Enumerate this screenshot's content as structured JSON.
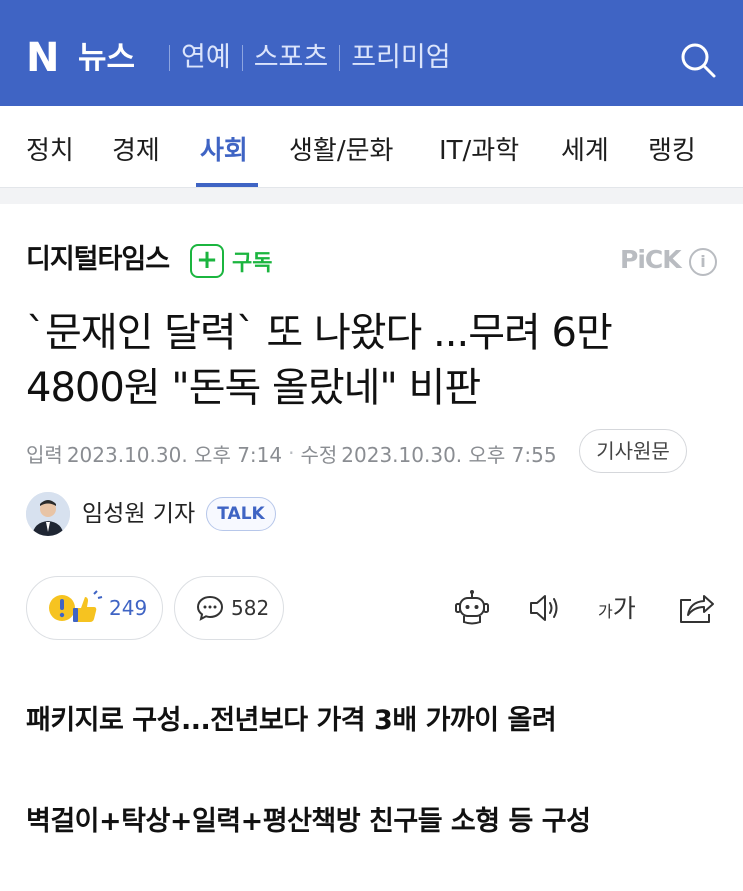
{
  "header": {
    "logo": "N",
    "brand": "뉴스",
    "nav": [
      "연예",
      "스포츠",
      "프리미엄"
    ],
    "search_icon": "search-icon"
  },
  "categories": {
    "items": [
      "정치",
      "경제",
      "사회",
      "생활/문화",
      "IT/과학",
      "세계",
      "랭킹"
    ],
    "active": "사회"
  },
  "press": {
    "name": "디지털타임스",
    "subscribe_label": "구독",
    "pick_label": "PiCK",
    "info_icon": "info-icon"
  },
  "article": {
    "title_line1": "`문재인 달력` 또 나왔다 ...무려 6만",
    "title_line2": "4800원 \"돈독 올랐네\" 비판",
    "published_label": "입력",
    "published": "2023.10.30. 오후 7:14",
    "modified_label": "수정",
    "modified": "2023.10.30. 오후 7:55",
    "original_button": "기사원문",
    "reporter": "임성원 기자",
    "talk_label": "TALK"
  },
  "reactions": {
    "reaction_count": "249",
    "comment_count": "582",
    "tools": [
      "robot-summary-icon",
      "speaker-icon",
      "font-size-icon",
      "share-icon"
    ],
    "font_size_small": "가",
    "font_size_large": "가"
  },
  "body": {
    "subhead1": "패키지로 구성...전년보다 가격 3배 가까이 올려",
    "subhead2": "벽걸이+탁상+일력+평산책방 친구들 소형 등 구성"
  },
  "colors": {
    "brand_blue": "#3f64c4",
    "subscribe_green": "#1bb53f",
    "muted_gray": "#8a8d92"
  }
}
